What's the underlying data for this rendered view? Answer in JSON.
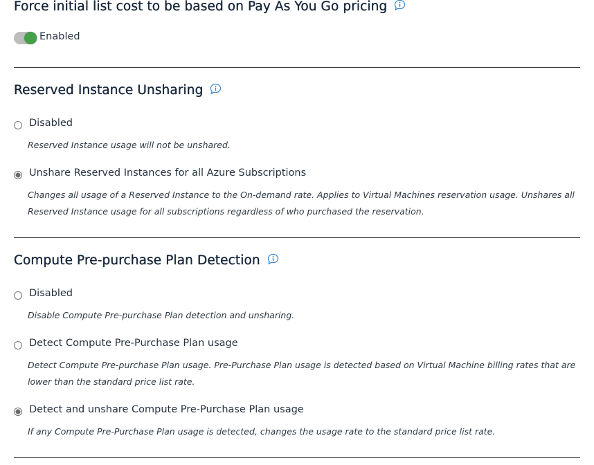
{
  "colors": {
    "toggle_on": "#43a047",
    "toggle_track": "#bdbdbd",
    "info_icon": "#3a86c8",
    "heading": "#16263a"
  },
  "pay_as_you_go": {
    "title": "Force initial list cost to be based on Pay As You Go pricing",
    "icon": "info-icon",
    "toggle": {
      "state": "on",
      "label": "Enabled"
    }
  },
  "ri_unsharing": {
    "title": "Reserved Instance Unsharing",
    "icon": "info-icon",
    "options": [
      {
        "label": "Disabled",
        "checked": false,
        "description": "Reserved Instance usage will not be unshared."
      },
      {
        "label": "Unshare Reserved Instances for all Azure Subscriptions",
        "checked": true,
        "description_line1": "Changes all usage of a Reserved Instance to the On-demand rate. Applies to Virtual Machines reservation usage. Unshares all",
        "description_line2": "Reserved Instance usage for all subscriptions regardless of who purchased the reservation."
      }
    ]
  },
  "compute_preplan": {
    "title": "Compute Pre-purchase Plan Detection",
    "icon": "info-icon",
    "options": [
      {
        "label": "Disabled",
        "checked": false,
        "description": "Disable Compute Pre-purchase Plan detection and unsharing."
      },
      {
        "label": "Detect Compute Pre-Purchase Plan usage",
        "checked": false,
        "description_line1": "Detect Compute Pre-purchase Plan usage. Pre-Purchase Plan usage is detected based on Virtual Machine billing rates that are",
        "description_line2": "lower than the standard price list rate."
      },
      {
        "label": "Detect and unshare Compute Pre-Purchase Plan usage",
        "checked": true,
        "description": "If any Compute Pre-Purchase Plan usage is detected, changes the usage rate to the standard price list rate."
      }
    ]
  }
}
